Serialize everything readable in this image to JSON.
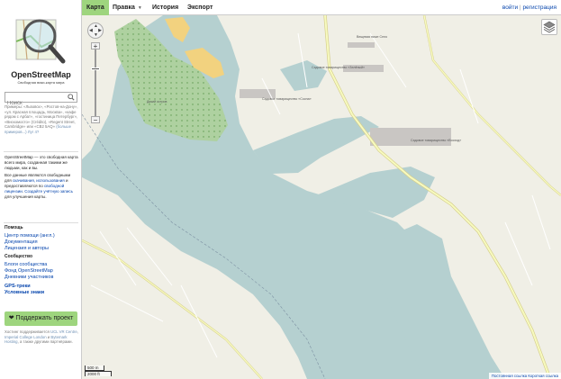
{
  "brand": {
    "name": "OpenStreetMap",
    "tagline": "Свободная вики-карта мира"
  },
  "search": {
    "placeholder": "Поиск"
  },
  "examples": {
    "text": "Примеры: «Львовск», «Ростов-на-Дону», «ул. Красная площадь, Москва», «кафе рядом с Арбат», «гостиница Петербург», «Вискомосто» (Crédito), «Regent Street, Cambridge» или «CB2 5AQ»",
    "link": "(больше примеров...)",
    "link2": "Луг 4?"
  },
  "about": {
    "p1": "OpenStreetMap — это свободная карта всего мира, созданная такими же людьми, как и вы.",
    "p2_pre": "Все данные являются свободными для ",
    "p2_link1": "скачивания, использования",
    "p2_mid": " и предоставляются по ",
    "p2_link2": "свободной лицензии",
    "p2_sep": ". ",
    "p2_link3": "Создайте учётную запись",
    "p2_post": " для улучшения карты."
  },
  "help": {
    "heading": "Помощь",
    "links": [
      "Центр помощи (англ.)",
      "Документация",
      "Лицензия и авторы"
    ]
  },
  "community": {
    "heading": "Сообщество",
    "links": [
      "Блоги сообщества",
      "Фонд OpenStreetMap",
      "Дневники участников"
    ]
  },
  "extra_links": [
    "GPS-треки",
    "Условные знаки"
  ],
  "donate": {
    "label": "Поддержать проект",
    "icon": "heart-icon"
  },
  "hosting": {
    "pre": "Хостинг поддерживается ",
    "link1": "UCL VR Centre",
    "mid1": ", ",
    "link2": "Imperial College London",
    "mid2": " и ",
    "link3": "Bytemark Hosting",
    "post": ", а также другими партнёрами."
  },
  "nav": {
    "tabs": [
      "Карта",
      "Правка",
      "История",
      "Экспорт"
    ],
    "edit_caret": "▼",
    "login": "войти",
    "separator": "|",
    "signup": "регистрация"
  },
  "map": {
    "scale_top": "500 m",
    "scale_bottom": "2000 ft",
    "attribution_link1": "Постоянная ссылка",
    "attribution_link2": "Короткая ссылка",
    "labels": {
      "nature": "Дикий остров",
      "settlement1": "Садовое товарищество «Сосна»",
      "settlement2": "Садовое товарищество «Зелёный»",
      "settlement3": "Садовое товарищество «Восход»",
      "settlement4": "Вещевая ниже Село"
    },
    "colors": {
      "water": "#b5d0d0",
      "land": "#f0efe6",
      "wood": "#aed1a0",
      "sand": "#f2d27f",
      "road": "#f7fabf",
      "road_border": "#d6cf8c",
      "buildings": "#c9c6c3"
    }
  }
}
